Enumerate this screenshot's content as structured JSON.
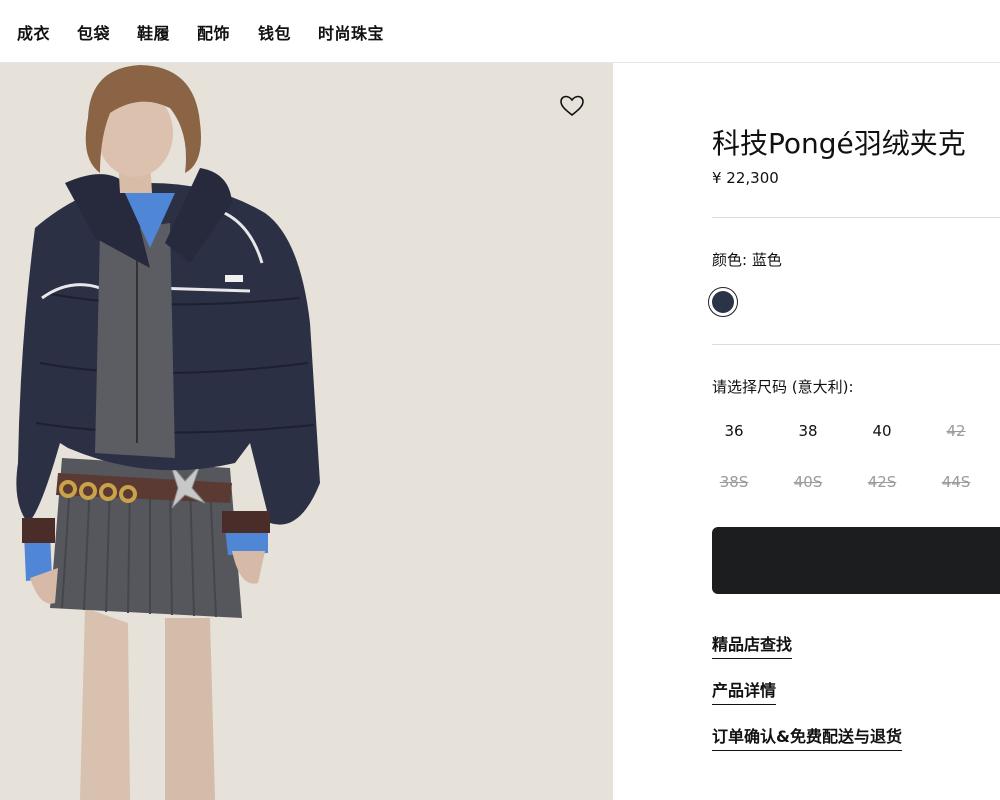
{
  "nav": {
    "items": [
      "成衣",
      "包袋",
      "鞋履",
      "配饰",
      "钱包",
      "时尚珠宝"
    ]
  },
  "product": {
    "title": "科技Pongé羽绒夹克",
    "price": "¥ 22,300",
    "color_label": "颜色:  蓝色",
    "swatch_color": "#2b3347",
    "size_label": "请选择尺码 (意大利):",
    "sizes_row1": [
      {
        "label": "36",
        "available": true
      },
      {
        "label": "38",
        "available": true
      },
      {
        "label": "40",
        "available": true
      },
      {
        "label": "42",
        "available": false
      }
    ],
    "sizes_row2": [
      {
        "label": "38S",
        "available": false
      },
      {
        "label": "40S",
        "available": false
      },
      {
        "label": "42S",
        "available": false
      },
      {
        "label": "44S",
        "available": false
      }
    ]
  },
  "links": {
    "store_finder": "精品店查找",
    "details": "产品详情",
    "shipping": "订单确认&免费配送与退货"
  },
  "colors": {
    "photo_bg": "#e6e2d9",
    "cta_bg": "#1c1d1f",
    "jacket": "#2b3045",
    "skirt": "#55575c",
    "shirt": "#4f86d6"
  }
}
